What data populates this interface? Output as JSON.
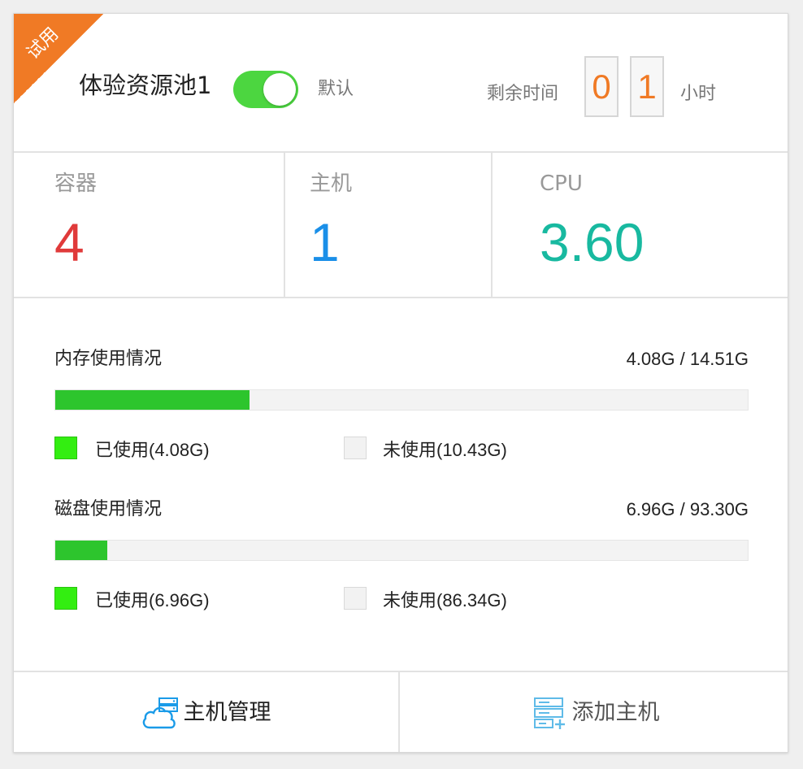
{
  "header": {
    "badge": "试用",
    "pool_name": "体验资源池1",
    "toggle_on": true,
    "default_label": "默认",
    "remaining_label": "剩余时间",
    "remaining_digits": [
      "0",
      "1"
    ],
    "hour_label": "小时"
  },
  "stats": [
    {
      "label": "容器",
      "value": "4",
      "color": "#e03a3a"
    },
    {
      "label": "主机",
      "value": "1",
      "color": "#1a8fe8"
    },
    {
      "label": "CPU",
      "value": "3.60",
      "color": "#18b9a0"
    }
  ],
  "memory": {
    "title": "内存使用情况",
    "total_text": "4.08G  / 14.51G",
    "used_fraction": 0.281,
    "used_text": "已使用(4.08G)",
    "free_text": "未使用(10.43G)"
  },
  "disk": {
    "title": "磁盘使用情况",
    "total_text": "6.96G / 93.30G",
    "used_fraction": 0.075,
    "used_text": "已使用(6.96G)",
    "free_text": "未使用(86.34G)"
  },
  "footer": {
    "host_manage": {
      "label": "主机管理",
      "icon": "cloud-server-icon"
    },
    "add_host": {
      "label": "添加主机",
      "icon": "add-server-icon"
    }
  },
  "colors": {
    "accent_orange": "#f07a25",
    "toggle_green": "#4cd640",
    "bar_green": "#2dc52d",
    "legend_used": "#33ee11"
  }
}
